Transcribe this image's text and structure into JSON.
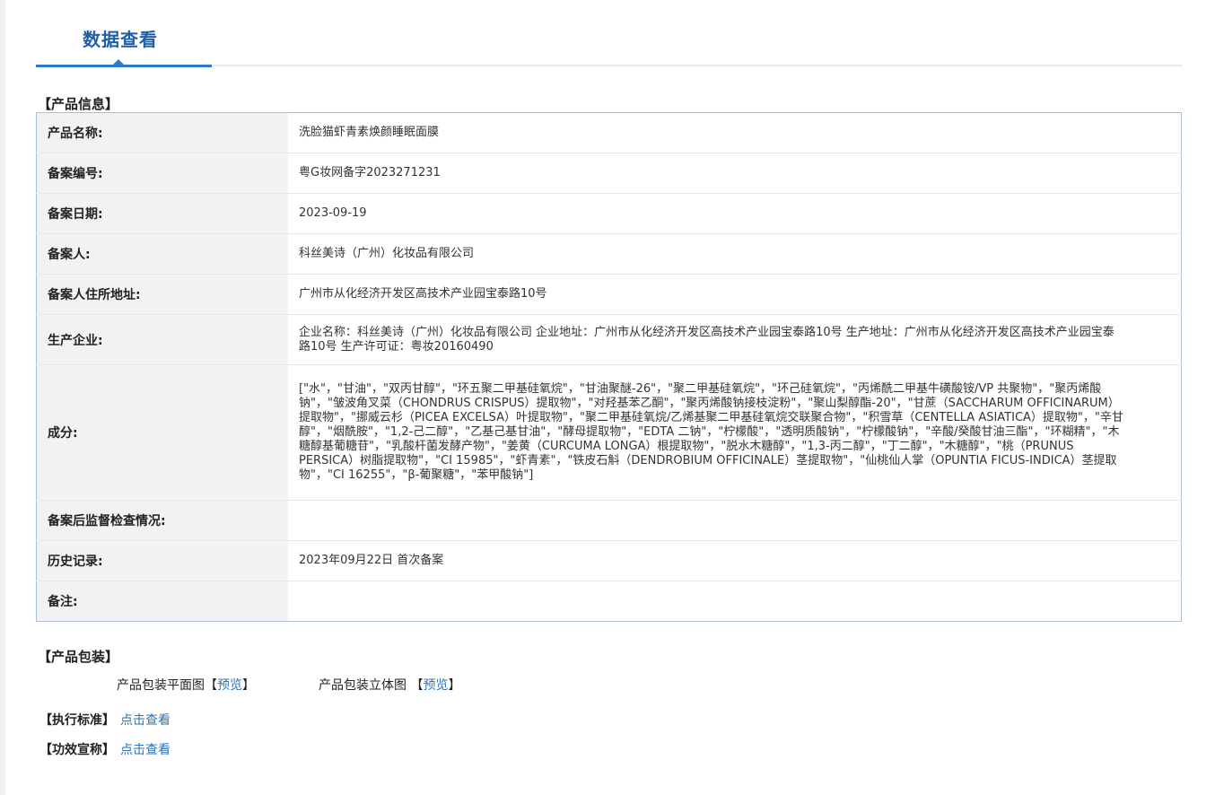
{
  "tab": {
    "title": "数据查看"
  },
  "sections": {
    "product_info": "【产品信息】",
    "packaging": "【产品包装】",
    "standard": "【执行标准】",
    "efficacy": "【功效宣称】"
  },
  "rows": [
    {
      "label": "产品名称:",
      "value": "洗脸猫虾青素焕颜睡眠面膜"
    },
    {
      "label": "备案编号:",
      "value": "粤G妆网备字2023271231"
    },
    {
      "label": "备案日期:",
      "value": "2023-09-19"
    },
    {
      "label": "备案人:",
      "value": "科丝美诗（广州）化妆品有限公司"
    },
    {
      "label": "备案人住所地址:",
      "value": "广州市从化经济开发区高技术产业园宝泰路10号"
    },
    {
      "label": "生产企业:",
      "value": "企业名称：科丝美诗（广州）化妆品有限公司 企业地址：广州市从化经济开发区高技术产业园宝泰路10号 生产地址：广州市从化经济开发区高技术产业园宝泰路10号 生产许可证：粤妆20160490"
    },
    {
      "label": "成分:",
      "value": "[\"水\"，\"甘油\"，\"双丙甘醇\"，\"环五聚二甲基硅氧烷\"，\"甘油聚醚-26\"，\"聚二甲基硅氧烷\"，\"环己硅氧烷\"，\"丙烯酰二甲基牛磺酸铵/VP 共聚物\"，\"聚丙烯酸钠\"，\"皱波角叉菜（CHONDRUS CRISPUS）提取物\"，\"对羟基苯乙酮\"，\"聚丙烯酸钠接枝淀粉\"，\"聚山梨醇酯-20\"，\"甘蔗（SACCHARUM OFFICINARUM）提取物\"，\"挪威云杉（PICEA EXCELSA）叶提取物\"，\"聚二甲基硅氧烷/乙烯基聚二甲基硅氧烷交联聚合物\"，\"积雪草（CENTELLA ASIATICA）提取物\"，\"辛甘醇\"，\"烟酰胺\"，\"1,2-己二醇\"，\"乙基己基甘油\"，\"酵母提取物\"，\"EDTA 二钠\"，\"柠檬酸\"，\"透明质酸钠\"，\"柠檬酸钠\"，\"辛酸/癸酸甘油三酯\"，\"环糊精\"，\"木糖醇基葡糖苷\"，\"乳酸杆菌发酵产物\"，\"姜黄（CURCUMA LONGA）根提取物\"，\"脱水木糖醇\"，\"1,3-丙二醇\"，\"丁二醇\"，\"木糖醇\"，\"桃（PRUNUS PERSICA）树脂提取物\"，\"CI 15985\"，\"虾青素\"，\"铁皮石斛（DENDROBIUM OFFICINALE）茎提取物\"，\"仙桃仙人掌（OPUNTIA FICUS-INDICA）茎提取物\"，\"CI 16255\"，\"β-葡聚糖\"，\"苯甲酸钠\"]"
    },
    {
      "label": "备案后监督检查情况:",
      "value": ""
    },
    {
      "label": "历史记录:",
      "value": "2023年09月22日 首次备案"
    },
    {
      "label": "备注:",
      "value": ""
    }
  ],
  "packaging": {
    "flat_label": "产品包装平面图",
    "flat_bracket_open": "【",
    "flat_link": "预览",
    "flat_bracket_close": "】",
    "solid_label": "产品包装立体图 ",
    "solid_bracket_open": "【",
    "solid_link": "预览",
    "solid_bracket_close": "】"
  },
  "links": {
    "standard": "点击查看",
    "efficacy": "点击查看"
  },
  "colors": {
    "accent": "#2b7cc9",
    "title": "#1f5fa6",
    "link": "#2b73b8",
    "table_border": "#a9bfd6",
    "label_bg": "#f2f2f2"
  }
}
